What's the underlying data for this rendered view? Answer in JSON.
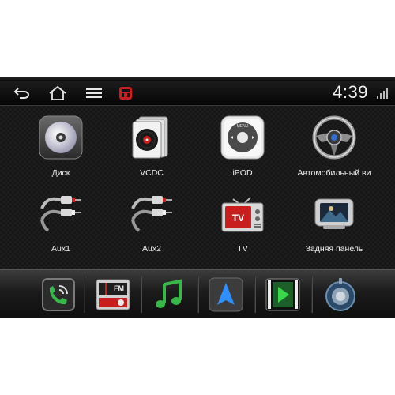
{
  "status_bar": {
    "clock": "4:39",
    "icons": [
      "back-icon",
      "home-icon",
      "menu-icon",
      "car-icon",
      "signal-icon"
    ]
  },
  "apps": [
    {
      "label": "Диск",
      "icon": "disc-icon"
    },
    {
      "label": "VCDC",
      "icon": "vcd-changer-icon"
    },
    {
      "label": "iPOD",
      "icon": "ipod-icon"
    },
    {
      "label": "Автомобильный ви",
      "icon": "steering-wheel-icon"
    },
    {
      "label": "Aux1",
      "icon": "rca-cable-icon"
    },
    {
      "label": "Aux2",
      "icon": "rca-cable-icon"
    },
    {
      "label": "TV",
      "icon": "tv-icon"
    },
    {
      "label": "Задняя панель",
      "icon": "rear-screen-icon"
    }
  ],
  "pager": {
    "pages": 5,
    "current_index": 1
  },
  "dock": {
    "items": [
      "phone-icon",
      "fm-radio-icon",
      "music-icon",
      "navigation-icon",
      "video-icon",
      "settings-icon"
    ],
    "fm_label": "FM"
  },
  "colors": {
    "accent_red": "#c81e1e",
    "nav_blue": "#2f8fff",
    "music_green": "#39b84a"
  }
}
